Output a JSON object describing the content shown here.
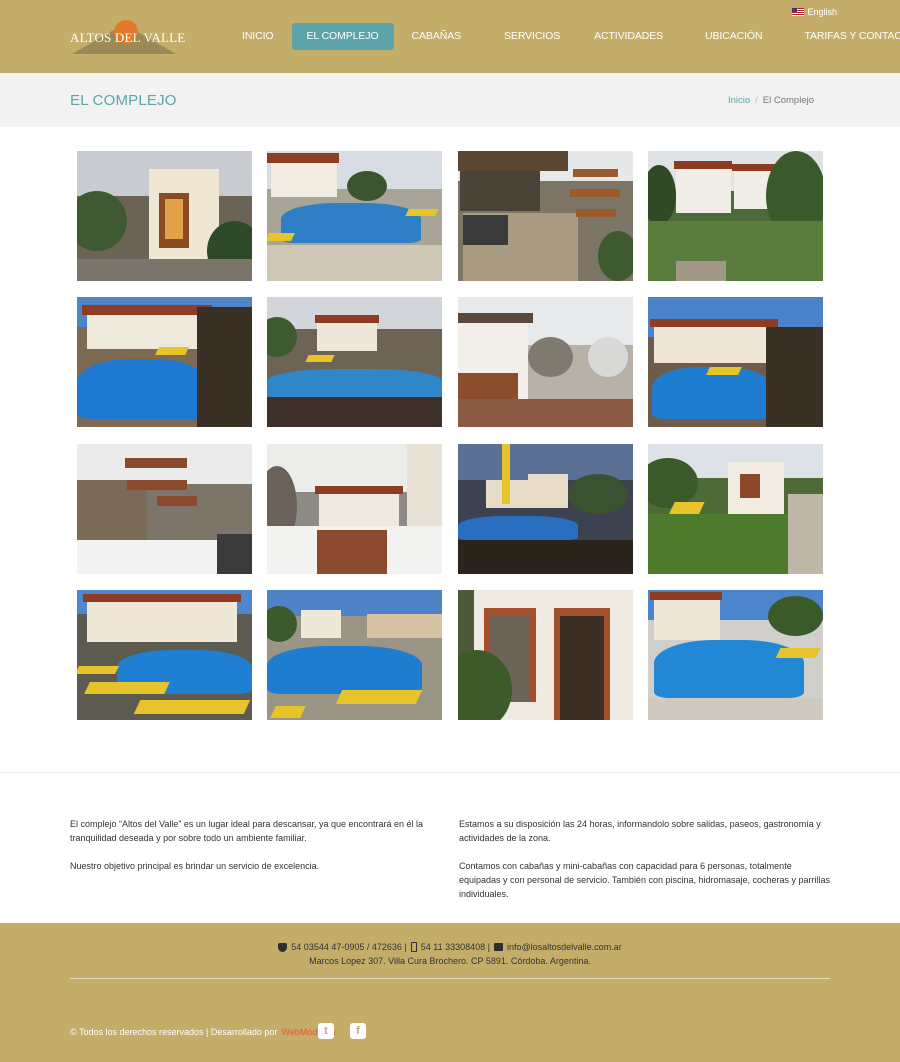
{
  "header": {
    "logo_text": "ALTOS DEL VALLE",
    "language": "English",
    "nav": [
      {
        "label": "INICIO",
        "active": false
      },
      {
        "label": "EL COMPLEJO",
        "active": true
      },
      {
        "label": "CABAÑAS",
        "active": false
      },
      {
        "label": "SERVICIOS",
        "active": false
      },
      {
        "label": "ACTIVIDADES",
        "active": false
      },
      {
        "label": "UBICACIÓN",
        "active": false
      },
      {
        "label": "TARIFAS Y CONTACTO",
        "active": false
      }
    ]
  },
  "page": {
    "title": "EL COMPLEJO",
    "breadcrumb": {
      "home": "Inicio",
      "separator": "/",
      "current": "El Complejo"
    }
  },
  "gallery": {
    "photos": [
      "entrance-dusk",
      "pool-view",
      "entrance-signs",
      "garden-lawn",
      "pool-sunny",
      "pool-fence",
      "snow-cabin",
      "pool-afternoon",
      "signs-snow",
      "snow-path",
      "pool-dusk",
      "cabin-garden",
      "pool-loungers",
      "pool-wide",
      "cabin-door",
      "pool-corner"
    ]
  },
  "about": {
    "left": [
      "El complejo “Altos del Valle” es un lugar ideal para descansar, ya que encontrará en él la tranquilidad deseada y por sobre todo un ambiente familiar.",
      "Nuestro objetivo principal es brindar un servicio de excelencia."
    ],
    "right": [
      "Estamos a su disposición las 24 horas, informandolo sobre salidas, paseos, gastronomía y actividades de la zona.",
      "Contamos con cabañas y mini-cabañas con capacidad para 6 personas, totalmente equipadas y con personal de servicio. También con piscina, hidromasaje, cocheras y parrillas individuales."
    ]
  },
  "footer": {
    "phone": "54 03544 47-0905 / 472636 |",
    "mobile": "54 11 33308408 |",
    "email": "info@losaltosdelvalle.com.ar",
    "address": "Marcos Lopez 307. Villa Cura Brochero. CP 5891. Córdoba. Argentina.",
    "copyright": "© Todos los derechos reservados | Desarrollado por",
    "developer": "WebModerna",
    "icons": [
      "twitter-icon",
      "facebook-icon"
    ]
  },
  "colors": {
    "header_bg": "#c4ad68",
    "accent": "#5da3a9",
    "footer_bg": "#c4ad68",
    "brand_link": "#e05a3a"
  }
}
